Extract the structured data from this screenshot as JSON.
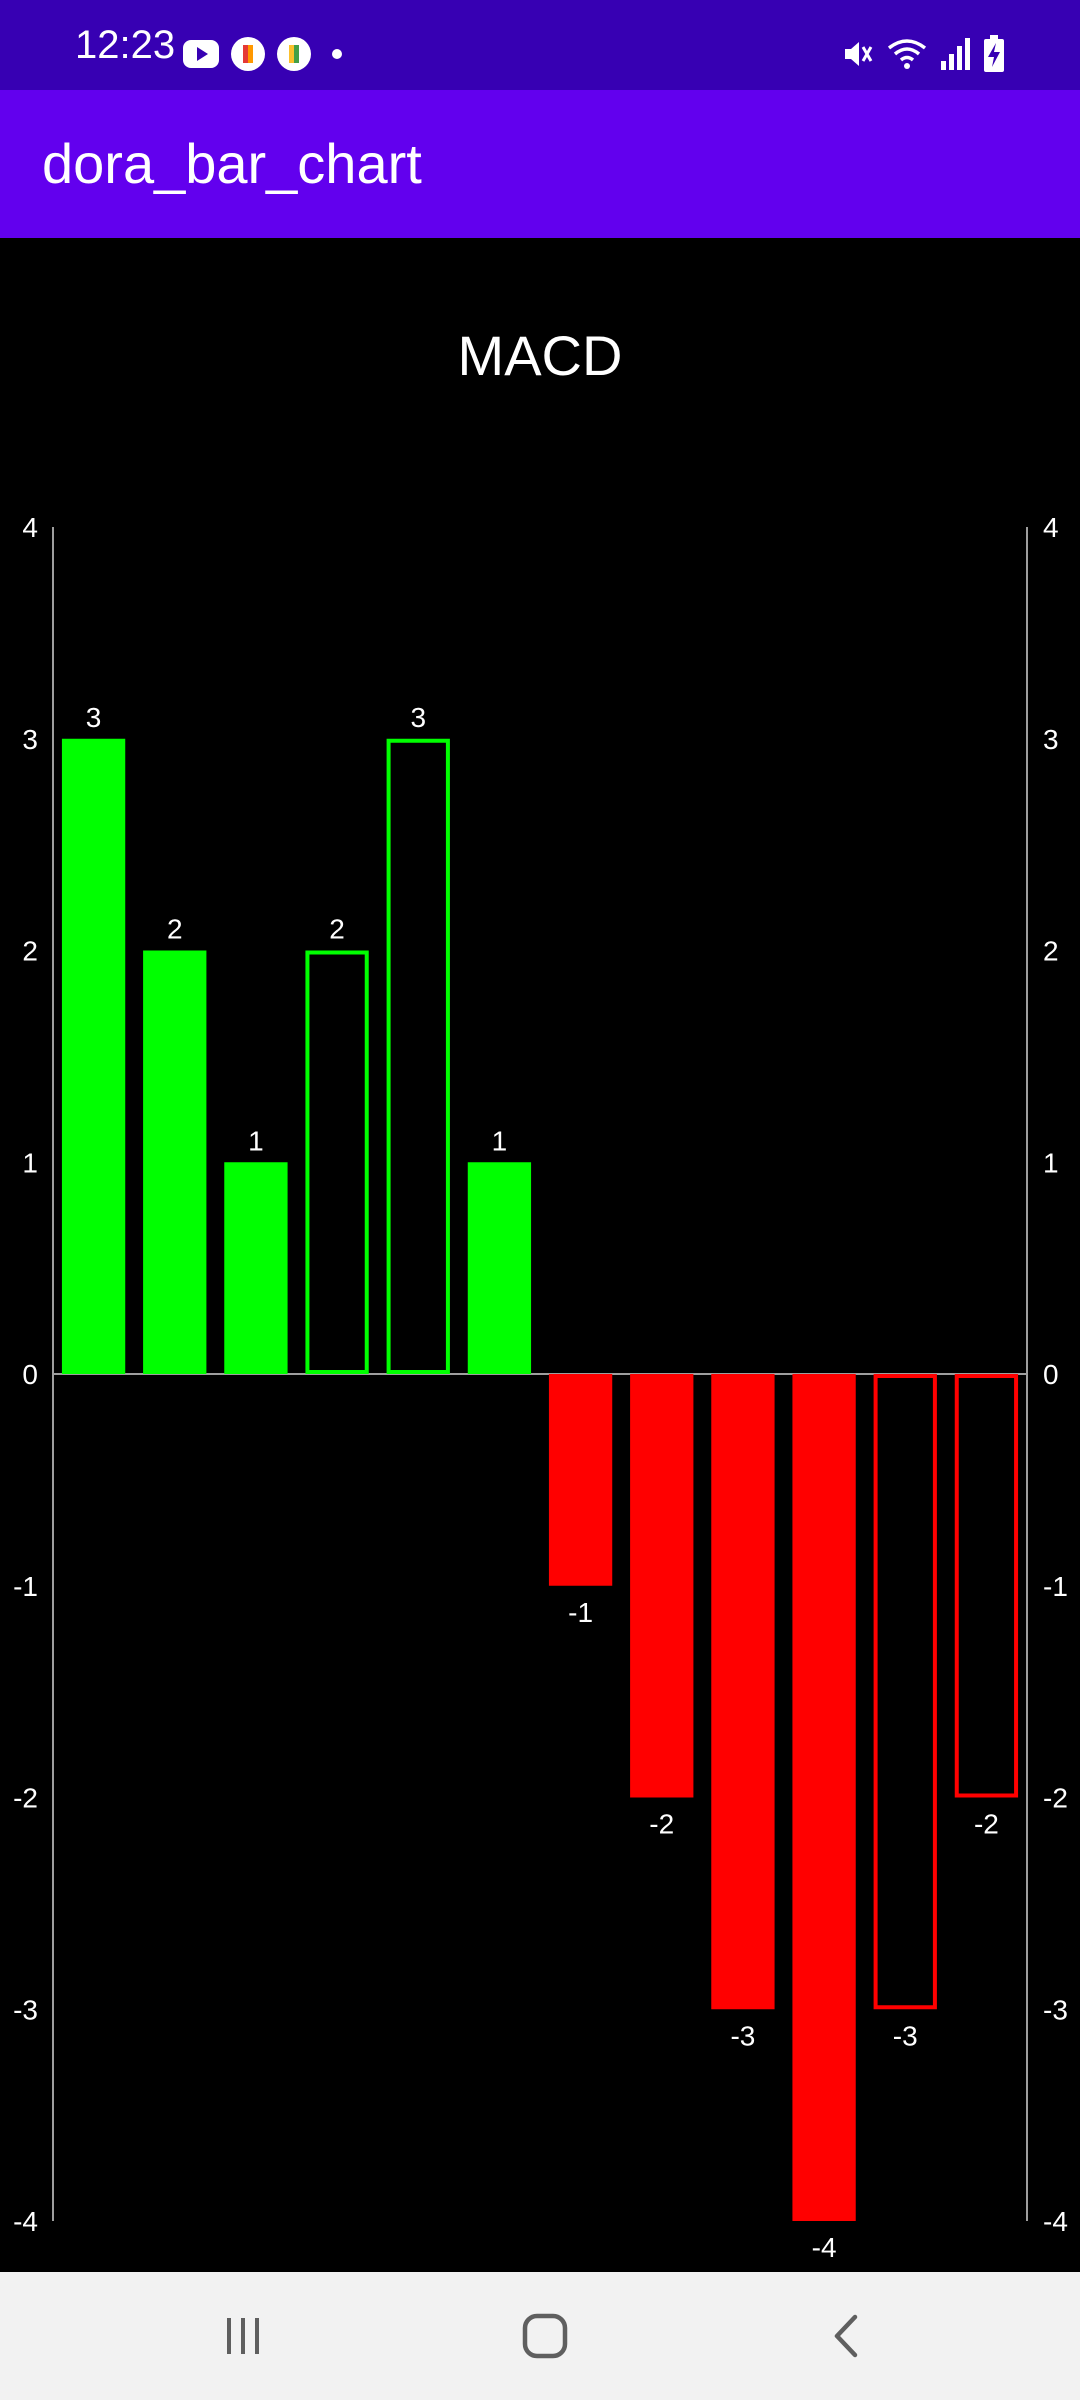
{
  "status_bar": {
    "time": "12:23",
    "left_icons": [
      "youtube-icon",
      "app-notification-icon",
      "app-notification-icon",
      "dot-icon"
    ],
    "right_icons": [
      "mute-icon",
      "wifi-icon",
      "signal-icon",
      "battery-charging-icon"
    ]
  },
  "app_bar": {
    "title": "dora_bar_chart"
  },
  "nav_bar": {
    "icons": [
      "recent-apps-icon",
      "home-icon",
      "back-icon"
    ]
  },
  "colors": {
    "status_bar": "#3700b3",
    "app_bar": "#6200ee",
    "positive": "#00ff00",
    "negative": "#ff0000",
    "axis": "#9e9e9e",
    "text": "#ffffff",
    "background": "#000000"
  },
  "chart_data": {
    "type": "bar",
    "title": "MACD",
    "xlabel": "",
    "ylabel": "",
    "ylim": [
      -4,
      4
    ],
    "yticks": [
      4,
      3,
      2,
      1,
      0,
      -1,
      -2,
      -3,
      -4
    ],
    "y_axes": [
      "left",
      "right"
    ],
    "grid": false,
    "values": [
      3,
      2,
      1,
      2,
      3,
      1,
      -1,
      -2,
      -3,
      -4,
      -3,
      -2
    ],
    "filled": [
      true,
      true,
      true,
      false,
      false,
      true,
      true,
      true,
      true,
      true,
      false,
      false
    ],
    "data_labels": [
      "3",
      "2",
      "1",
      "2",
      "3",
      "1",
      "-1",
      "-2",
      "-3",
      "-4",
      "-3",
      "-2"
    ]
  }
}
